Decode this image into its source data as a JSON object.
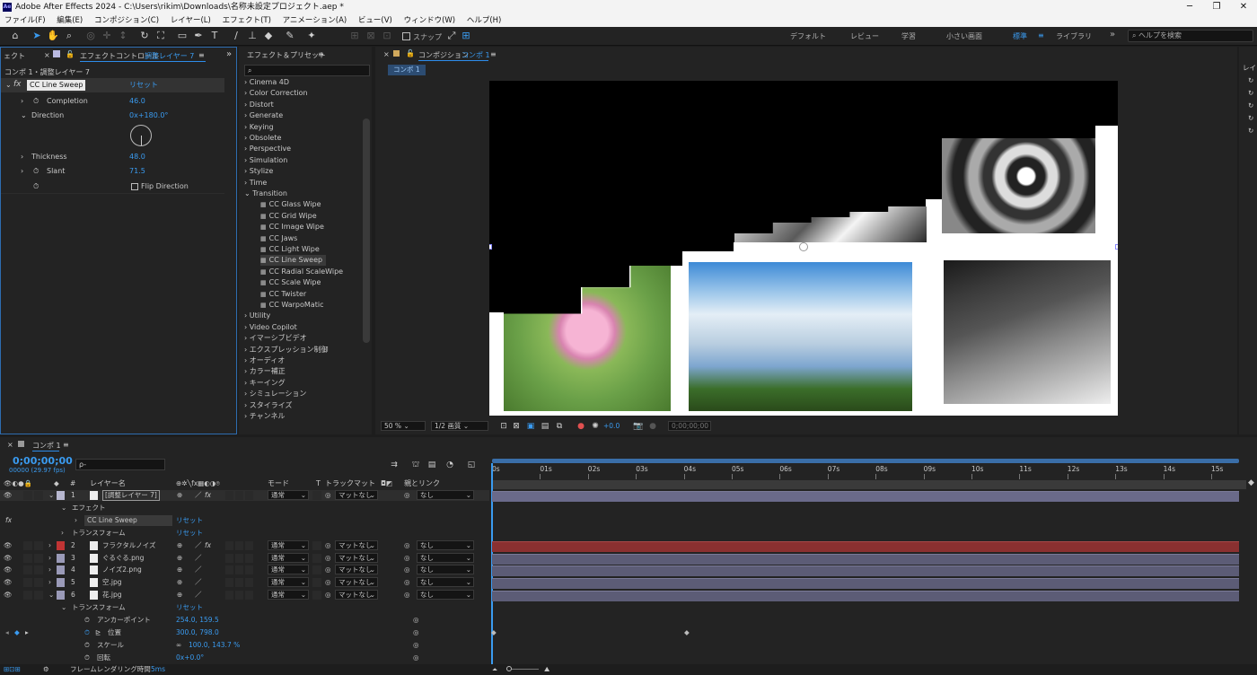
{
  "title": "Adobe After Effects 2024 - C:\\Users\\rikim\\Downloads\\名称未設定プロジェクト.aep *",
  "app_logo": "Ae",
  "menu": [
    "ファイル(F)",
    "編集(E)",
    "コンポジション(C)",
    "レイヤー(L)",
    "エフェクト(T)",
    "アニメーション(A)",
    "ビュー(V)",
    "ウィンドウ(W)",
    "ヘルプ(H)"
  ],
  "toolbar": {
    "snap": "スナップ",
    "workspaces": [
      "デフォルト",
      "レビュー",
      "学習",
      "小さい画面",
      "標準",
      "ライブラリ"
    ],
    "active_workspace": "標準",
    "more": "»",
    "help_placeholder": "ヘルプを検索"
  },
  "effect_controls": {
    "tab_left": "ェクト",
    "tab_title": "エフェクトコントロール",
    "tab_layer": "調整レイヤー 7",
    "subtitle": "コンポ 1・調整レイヤー 7",
    "effect_name": "CC Line Sweep",
    "reset": "リセット",
    "props": [
      {
        "name": "Completion",
        "value": "46.0"
      },
      {
        "name": "Direction",
        "value": "0x+180.0°"
      },
      {
        "name": "Thickness",
        "value": "48.0"
      },
      {
        "name": "Slant",
        "value": "71.5"
      }
    ],
    "flip": "Flip Direction"
  },
  "effects_presets": {
    "title": "エフェクト＆プリセット",
    "search_icon": "⌕",
    "categories_top": [
      "Cinema 4D",
      "Color Correction",
      "Distort",
      "Generate",
      "Keying",
      "Obsolete",
      "Perspective",
      "Simulation",
      "Stylize",
      "Time",
      "Transition"
    ],
    "transition_items": [
      "CC Glass Wipe",
      "CC Grid Wipe",
      "CC Image Wipe",
      "CC Jaws",
      "CC Light Wipe",
      "CC Line Sweep",
      "CC Radial ScaleWipe",
      "CC Scale Wipe",
      "CC Twister",
      "CC WarpoMatic"
    ],
    "selected_item": "CC Line Sweep",
    "categories_bottom": [
      "Utility",
      "Video Copilot",
      "イマーシブビデオ",
      "エクスプレッション制御",
      "オーディオ",
      "カラー補正",
      "キーイング",
      "シミュレーション",
      "スタイライズ",
      "チャンネル"
    ]
  },
  "composition": {
    "tab_label": "コンポジション",
    "comp_name": "コンポ 1",
    "zoom": "50 %",
    "resolution": "1/2 画質",
    "exposure": "+0.0",
    "timecode": "0;00;00;00"
  },
  "timeline": {
    "tab": "コンポ 1",
    "timecode": "0;00;00;00",
    "frame_info": "00000 (29.97 fps)",
    "search_placeholder": "ρ-",
    "col_layer_name": "レイヤー名",
    "col_mode": "モード",
    "col_t": "T",
    "col_trackmatte": "トラックマット",
    "col_parent": "親とリンク",
    "ruler": [
      "0s",
      "01s",
      "02s",
      "03s",
      "04s",
      "05s",
      "06s",
      "07s",
      "08s",
      "09s",
      "10s",
      "11s",
      "12s",
      "13s",
      "14s",
      "15s"
    ],
    "layers": [
      {
        "num": "1",
        "name": "[調整レイヤー 7]",
        "color": "#b8b8d0",
        "mode": "通常",
        "matte": "マットなし",
        "parent": "なし"
      },
      {
        "num": "2",
        "name": "フラクタルノイズ",
        "color": "#c03434",
        "mode": "通常",
        "matte": "マットなし",
        "parent": "なし"
      },
      {
        "num": "3",
        "name": "ぐるぐる.png",
        "color": "#9a9ab8",
        "mode": "通常",
        "matte": "マットなし",
        "parent": "なし"
      },
      {
        "num": "4",
        "name": "ノイズ2.png",
        "color": "#9a9ab8",
        "mode": "通常",
        "matte": "マットなし",
        "parent": "なし"
      },
      {
        "num": "5",
        "name": "空.jpg",
        "color": "#9a9ab8",
        "mode": "通常",
        "matte": "マットなし",
        "parent": "なし"
      },
      {
        "num": "6",
        "name": "花.jpg",
        "color": "#9a9ab8",
        "mode": "通常",
        "matte": "マットなし",
        "parent": "なし"
      }
    ],
    "effect_group": "エフェクト",
    "effect_name": "CC Line Sweep",
    "transform": "トランスフォーム",
    "reset": "リセット",
    "fx_label": "fx",
    "transform_props": [
      {
        "name": "アンカーポイント",
        "value": "254.0, 159.5"
      },
      {
        "name": "位置",
        "value": "300.0, 798.0"
      },
      {
        "name": "スケール",
        "value": "100.0, 143.7 %"
      },
      {
        "name": "回転",
        "value": "0x+0.0°"
      }
    ],
    "render_time_label": "フレームレンダリング時間",
    "render_time": "5ms"
  }
}
